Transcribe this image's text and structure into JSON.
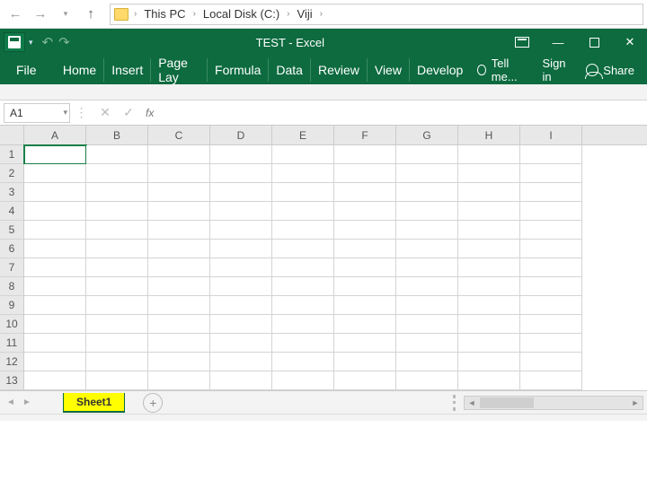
{
  "explorer": {
    "crumbs": [
      "This PC",
      "Local Disk (C:)",
      "Viji"
    ]
  },
  "title": "TEST - Excel",
  "ribbon": {
    "file": "File",
    "tabs": [
      "Home",
      "Insert",
      "Page Lay",
      "Formula",
      "Data",
      "Review",
      "View",
      "Develop"
    ],
    "tell_me": "Tell me...",
    "signin": "Sign in",
    "share": "Share"
  },
  "namebox": "A1",
  "fx": "fx",
  "columns": [
    "A",
    "B",
    "C",
    "D",
    "E",
    "F",
    "G",
    "H",
    "I"
  ],
  "rows": [
    "1",
    "2",
    "3",
    "4",
    "5",
    "6",
    "7",
    "8",
    "9",
    "10",
    "11",
    "12",
    "13"
  ],
  "active_cell": "A1",
  "sheet_tab": "Sheet1"
}
